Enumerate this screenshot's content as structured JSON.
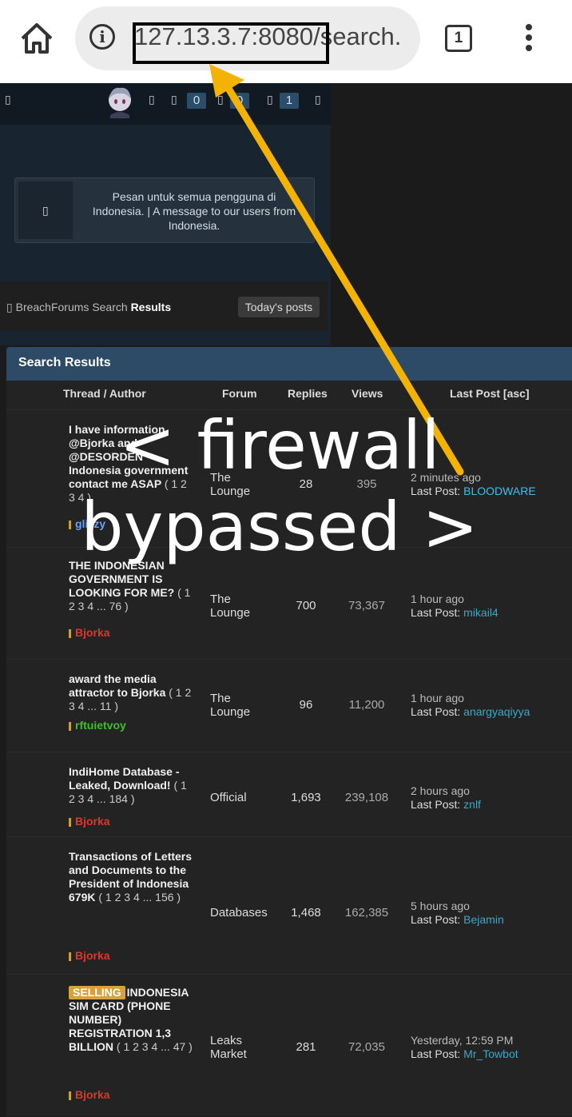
{
  "browser": {
    "url": "127.13.3.7:8080/search.",
    "tab_count": "1",
    "info_glyph": "i"
  },
  "header": {
    "glyphs": [
      "▯",
      "▯",
      "▯",
      "▯",
      "▯",
      "▯"
    ],
    "counters": [
      "0",
      "0",
      "1"
    ]
  },
  "notice": {
    "icon": "▯",
    "text": "Pesan untuk semua pengguna di Indonesia. | A message to our users from Indonesia."
  },
  "breadcrumb": {
    "icon": "▯",
    "site": "BreachForums",
    "section": "Search",
    "current": "Results",
    "todays_posts": "Today's posts"
  },
  "results": {
    "heading": "Search Results",
    "columns": {
      "thread": "Thread / Author",
      "forum": "Forum",
      "replies": "Replies",
      "views": "Views",
      "last_post": "Last Post [asc]"
    },
    "last_post_label": "Last Post: ",
    "rows": [
      {
        "title": "I have information @Bjorka and @DESORDEN Indonesia government contact me ASAP",
        "pages": "( 1 2 3 4 )",
        "tag": "",
        "author": "glizzy",
        "author_color": "#6aa0ff",
        "forum": "The Lounge",
        "replies": "28",
        "views": "395",
        "time": "2 minutes ago",
        "user": "BLOODWARE",
        "user_color": "#36c2f0"
      },
      {
        "title": "THE INDONESIAN GOVERNMENT IS LOOKING FOR ME?",
        "pages": "( 1 2 3 4 ... 76 )",
        "tag": "",
        "author": "Bjorka",
        "author_color": "#d9382d",
        "forum": "The Lounge",
        "replies": "700",
        "views": "73,367",
        "time": "1 hour ago",
        "user": "mikail4",
        "user_color": "#38a8c9"
      },
      {
        "title": "award the media attractor to Bjorka",
        "pages": "( 1 2 3 4 ... 11 )",
        "tag": "",
        "author": "rftuietvoy",
        "author_color": "#3fbf2c",
        "forum": "The Lounge",
        "replies": "96",
        "views": "11,200",
        "time": "1 hour ago",
        "user": "anargyaqiyya",
        "user_color": "#38a8c9"
      },
      {
        "title": "IndiHome Database - Leaked, Download!",
        "pages": "( 1 2 3 4 ... 184 )",
        "tag": "",
        "author": "Bjorka",
        "author_color": "#d9382d",
        "forum": "Official",
        "replies": "1,693",
        "views": "239,108",
        "time": "2 hours ago",
        "user": "znlf",
        "user_color": "#38a8c9"
      },
      {
        "title": "Transactions of Letters and Documents to the President of Indonesia 679K",
        "pages": "( 1 2 3 4 ... 156 )",
        "tag": "",
        "author": "Bjorka",
        "author_color": "#d9382d",
        "forum": "Databases",
        "replies": "1,468",
        "views": "162,385",
        "time": "5 hours ago",
        "user": "Bejamin",
        "user_color": "#38a8c9"
      },
      {
        "title": "INDONESIA SIM CARD (PHONE NUMBER) REGISTRATION 1,3 BILLION",
        "pages": "( 1 2 3 4 ... 47 )",
        "tag": "SELLING",
        "author": "Bjorka",
        "author_color": "#d9382d",
        "forum": "Leaks Market",
        "replies": "281",
        "views": "72,035",
        "time": "Yesterday, 12:59 PM",
        "user": "Mr_Towbot",
        "user_color": "#38a8c9"
      }
    ]
  },
  "overlay": {
    "text": "< firewall bypassed >",
    "arrow_color": "#f5b301"
  }
}
